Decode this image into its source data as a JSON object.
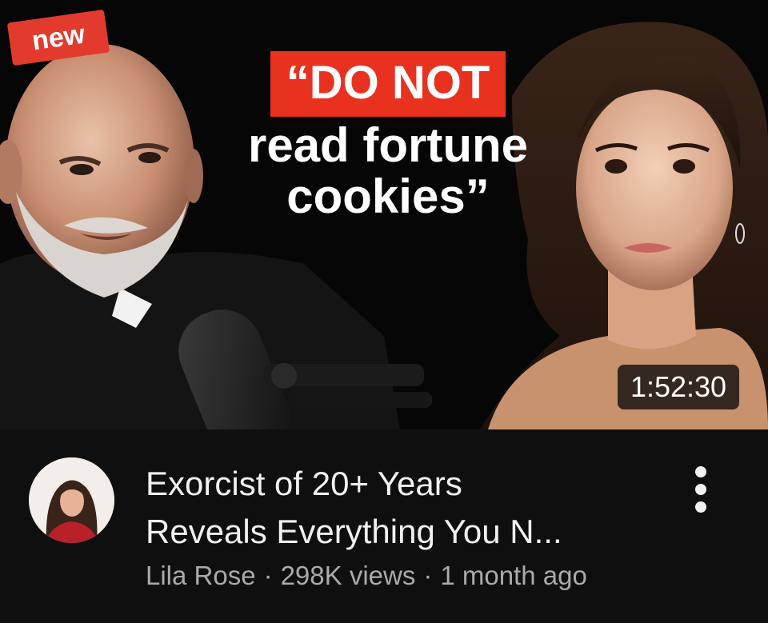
{
  "thumbnail": {
    "badge": "new",
    "quote_line1": "“DO NOT",
    "quote_line2": "read fortune",
    "quote_line3": "cookies”",
    "duration": "1:52:30",
    "accent_color": "#e8311f"
  },
  "video": {
    "title_line1": "Exorcist of 20+ Years",
    "title_line2": "Reveals Everything You N...",
    "channel": "Lila Rose",
    "separator": "·",
    "views": "298K views",
    "age": "1 month ago"
  },
  "icons": {
    "more_options": "more-vert-icon"
  }
}
